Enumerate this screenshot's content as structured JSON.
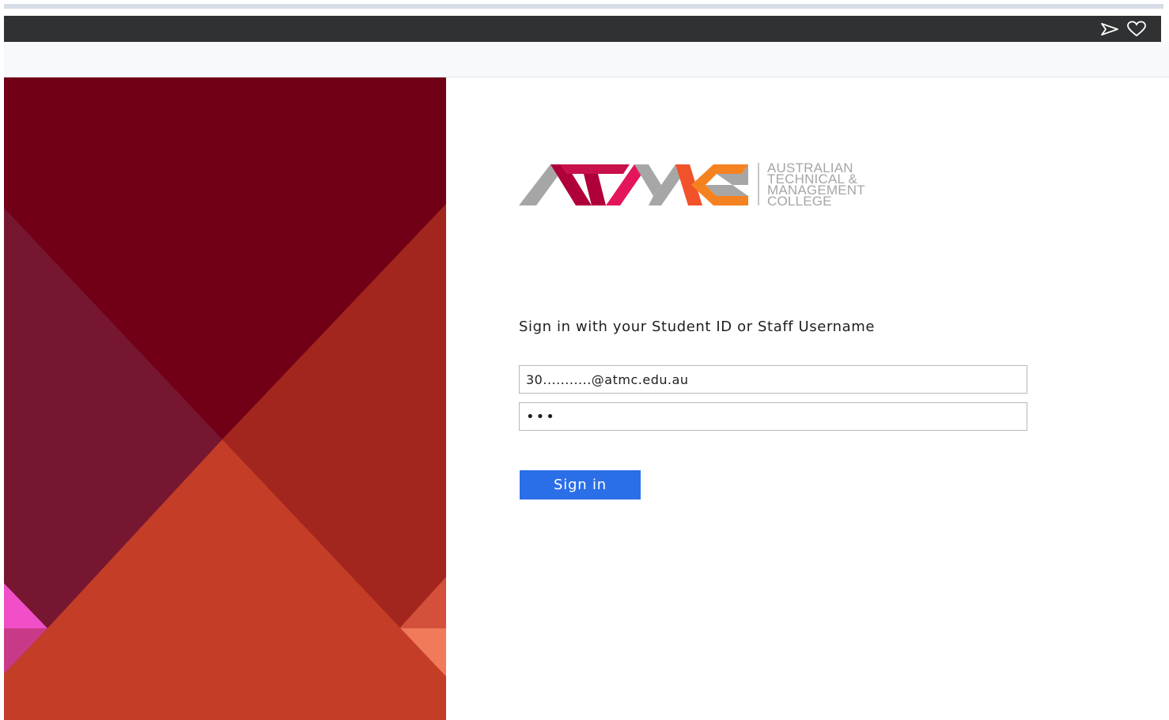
{
  "browser": {
    "toolbar_icons": [
      "send-icon",
      "heart-icon"
    ]
  },
  "brand": {
    "logo_mark": "ATMC",
    "name_lines": [
      "AUSTRALIAN",
      "TECHNICAL &",
      "MANAGEMENT",
      "COLLEGE"
    ],
    "colors": {
      "crimson": "#b0003a",
      "magenta": "#e3165b",
      "orange": "#f58220",
      "grey": "#a6a6a6"
    }
  },
  "login": {
    "heading": "Sign in with your Student ID or Staff Username",
    "username_value": "30...........@atmc.edu.au",
    "password_value": "•••",
    "submit_label": "Sign in",
    "accent_color": "#2b6fe8"
  },
  "panel_colors": {
    "dark_red": "#710017",
    "wine": "#771631",
    "rust": "#a3261e",
    "orange_red": "#c43d27",
    "pink": "#f04fc8",
    "salmon": "#f07a5a"
  }
}
